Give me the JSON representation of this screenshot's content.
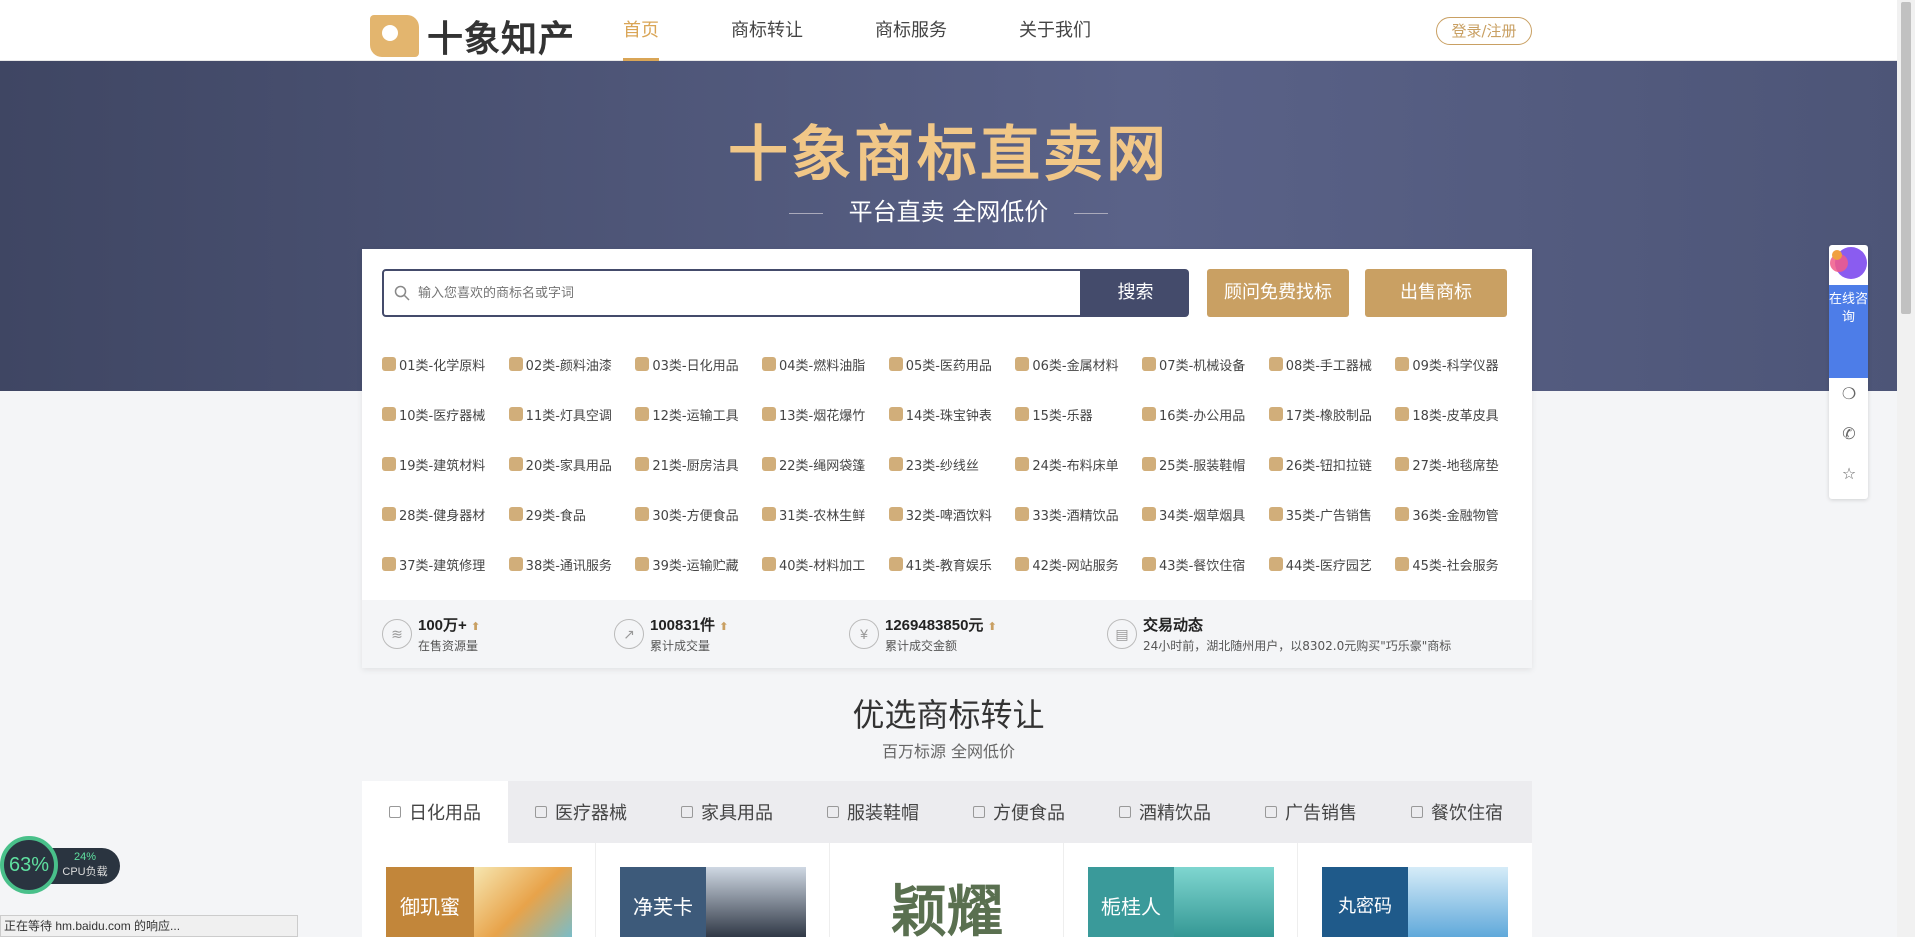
{
  "header": {
    "logo_text": "十象知产",
    "nav": [
      "首页",
      "商标转让",
      "商标服务",
      "关于我们"
    ],
    "login_label": "登录/注册"
  },
  "hero": {
    "title": "十象商标直卖网",
    "subtitle": "平台直卖 全网低价"
  },
  "search": {
    "placeholder": "输入您喜欢的商标名或字词",
    "button_label": "搜索",
    "advisor_button": "顾问免费找标",
    "sell_button": "出售商标"
  },
  "categories": [
    [
      "01类-化学原料",
      "02类-颜料油漆",
      "03类-日化用品",
      "04类-燃料油脂",
      "05类-医药用品",
      "06类-金属材料",
      "07类-机械设备",
      "08类-手工器械",
      "09类-科学仪器"
    ],
    [
      "10类-医疗器械",
      "11类-灯具空调",
      "12类-运输工具",
      "13类-烟花爆竹",
      "14类-珠宝钟表",
      "15类-乐器",
      "16类-办公用品",
      "17类-橡胶制品",
      "18类-皮革皮具"
    ],
    [
      "19类-建筑材料",
      "20类-家具用品",
      "21类-厨房洁具",
      "22类-绳网袋篷",
      "23类-纱线丝",
      "24类-布料床单",
      "25类-服装鞋帽",
      "26类-钮扣拉链",
      "27类-地毯席垫"
    ],
    [
      "28类-健身器材",
      "29类-食品",
      "30类-方便食品",
      "31类-农林生鲜",
      "32类-啤酒饮料",
      "33类-酒精饮品",
      "34类-烟草烟具",
      "35类-广告销售",
      "36类-金融物管"
    ],
    [
      "37类-建筑修理",
      "38类-通讯服务",
      "39类-运输贮藏",
      "40类-材料加工",
      "41类-教育娱乐",
      "42类-网站服务",
      "43类-餐饮住宿",
      "44类-医疗园艺",
      "45类-社会服务"
    ]
  ],
  "stats": {
    "resources_value": "100万+",
    "resources_label": "在售资源量",
    "deals_value": "100831件",
    "deals_label": "累计成交量",
    "amount_value": "1269483850元",
    "amount_label": "累计成交金额",
    "trade_title": "交易动态",
    "trade_text": "24小时前，湖北随州用户，以8302.0元购买\"巧乐豪\"商标",
    "arrow": "⬆"
  },
  "section": {
    "title": "优选商标转让",
    "subtitle": "百万标源 全网低价"
  },
  "tabs": [
    "日化用品",
    "医疗器械",
    "家具用品",
    "服装鞋帽",
    "方便食品",
    "酒精饮品",
    "广告销售",
    "餐饮住宿"
  ],
  "cards": [
    {
      "brand": "御玑蜜",
      "accent": "#c2863a"
    },
    {
      "brand": "净芙卡",
      "accent": "#3d5a7a"
    },
    {
      "brand": "颖耀",
      "accent": "#5a7050"
    },
    {
      "brand": "栀桂人",
      "accent": "#3a9a9a"
    },
    {
      "brand": "丸密码",
      "accent": "#1f5a8a"
    }
  ],
  "side": {
    "consult_label": "在线咨询"
  },
  "cpu": {
    "percent": "63%",
    "load_percent": "24%",
    "load_label": "CPU负载"
  },
  "status_text": "正在等待 hm.baidu.com 的响应..."
}
